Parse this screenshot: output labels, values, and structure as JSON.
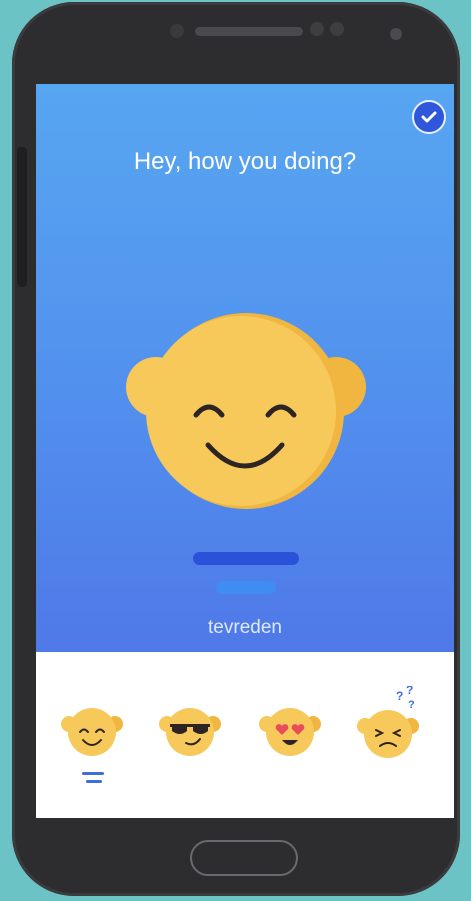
{
  "app": {
    "greeting": "Hey, how you doing?",
    "current_mood_label": "tevreden",
    "confirm_icon": "check-icon"
  },
  "mood_options": [
    {
      "name": "smiling-face-icon",
      "selected": true
    },
    {
      "name": "sunglasses-face-icon",
      "selected": false
    },
    {
      "name": "heart-eyes-face-icon",
      "selected": false
    },
    {
      "name": "confused-face-icon",
      "selected": false
    }
  ],
  "colors": {
    "accent": "#2f57db",
    "face": "#f7c85a",
    "face_shade": "#f0b640",
    "hero_top": "#57a6f1",
    "hero_bottom": "#4f79e8"
  }
}
